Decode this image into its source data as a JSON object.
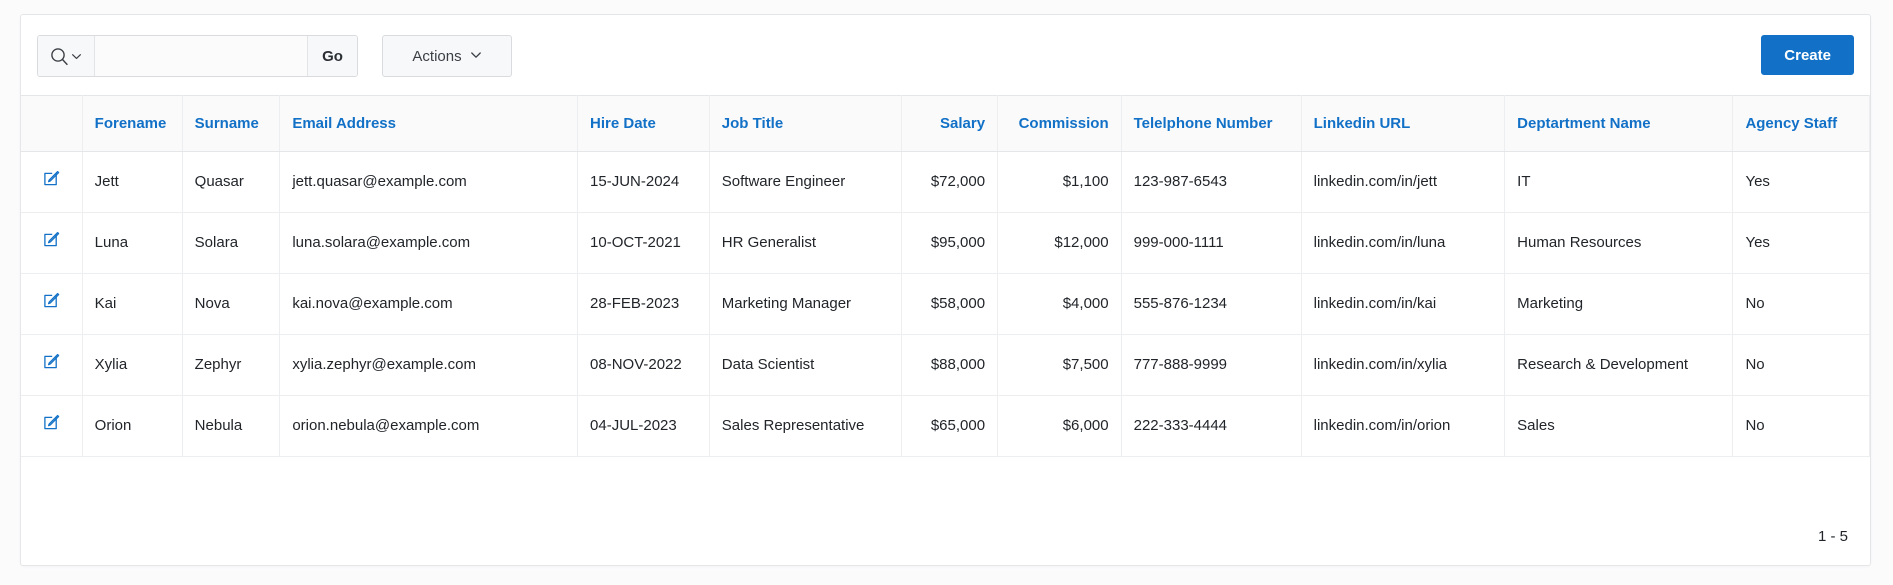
{
  "toolbar": {
    "search_icon": "search-icon",
    "search_dropdown_icon": "chevron-down-icon",
    "search_value": "",
    "search_placeholder": "",
    "go_label": "Go",
    "actions_label": "Actions",
    "actions_dropdown_icon": "chevron-down-icon",
    "create_label": "Create"
  },
  "colors": {
    "accent": "#1271c7",
    "header_text": "#1271c7",
    "body_text": "#21252a",
    "border": "#e4e6e8",
    "toolbar_button_bg": "#f7f8f9"
  },
  "table": {
    "edit_icon": "edit-pencil-icon",
    "columns": [
      {
        "label": "",
        "align": "center",
        "key": "edit"
      },
      {
        "label": "Forename",
        "align": "left",
        "key": "forename"
      },
      {
        "label": "Surname",
        "align": "left",
        "key": "surname"
      },
      {
        "label": "Email Address",
        "align": "left",
        "key": "email"
      },
      {
        "label": "Hire Date",
        "align": "left",
        "key": "hire_date"
      },
      {
        "label": "Job Title",
        "align": "left",
        "key": "job_title"
      },
      {
        "label": "Salary",
        "align": "right",
        "key": "salary"
      },
      {
        "label": "Commission",
        "align": "right",
        "key": "commission"
      },
      {
        "label": "Telelphone Number",
        "align": "left",
        "key": "telephone"
      },
      {
        "label": "Linkedin URL",
        "align": "left",
        "key": "linkedin"
      },
      {
        "label": "Deptartment Name",
        "align": "left",
        "key": "department"
      },
      {
        "label": "Agency Staff",
        "align": "left",
        "key": "agency_staff"
      }
    ],
    "rows": [
      {
        "forename": "Jett",
        "surname": "Quasar",
        "email": "jett.quasar@example.com",
        "hire_date": "15-JUN-2024",
        "job_title": "Software Engineer",
        "salary": "$72,000",
        "commission": "$1,100",
        "telephone": "123-987-6543",
        "linkedin": "linkedin.com/in/jett",
        "department": "IT",
        "agency_staff": "Yes"
      },
      {
        "forename": "Luna",
        "surname": "Solara",
        "email": "luna.solara@example.com",
        "hire_date": "10-OCT-2021",
        "job_title": "HR Generalist",
        "salary": "$95,000",
        "commission": "$12,000",
        "telephone": "999-000-1111",
        "linkedin": "linkedin.com/in/luna",
        "department": "Human Resources",
        "agency_staff": "Yes"
      },
      {
        "forename": "Kai",
        "surname": "Nova",
        "email": "kai.nova@example.com",
        "hire_date": "28-FEB-2023",
        "job_title": "Marketing Manager",
        "salary": "$58,000",
        "commission": "$4,000",
        "telephone": "555-876-1234",
        "linkedin": "linkedin.com/in/kai",
        "department": "Marketing",
        "agency_staff": "No"
      },
      {
        "forename": "Xylia",
        "surname": "Zephyr",
        "email": "xylia.zephyr@example.com",
        "hire_date": "08-NOV-2022",
        "job_title": "Data Scientist",
        "salary": "$88,000",
        "commission": "$7,500",
        "telephone": "777-888-9999",
        "linkedin": "linkedin.com/in/xylia",
        "department": "Research & Development",
        "agency_staff": "No"
      },
      {
        "forename": "Orion",
        "surname": "Nebula",
        "email": "orion.nebula@example.com",
        "hire_date": "04-JUL-2023",
        "job_title": "Sales Representative",
        "salary": "$65,000",
        "commission": "$6,000",
        "telephone": "222-333-4444",
        "linkedin": "linkedin.com/in/orion",
        "department": "Sales",
        "agency_staff": "No"
      }
    ]
  },
  "pagination": {
    "range_label": "1 - 5"
  }
}
